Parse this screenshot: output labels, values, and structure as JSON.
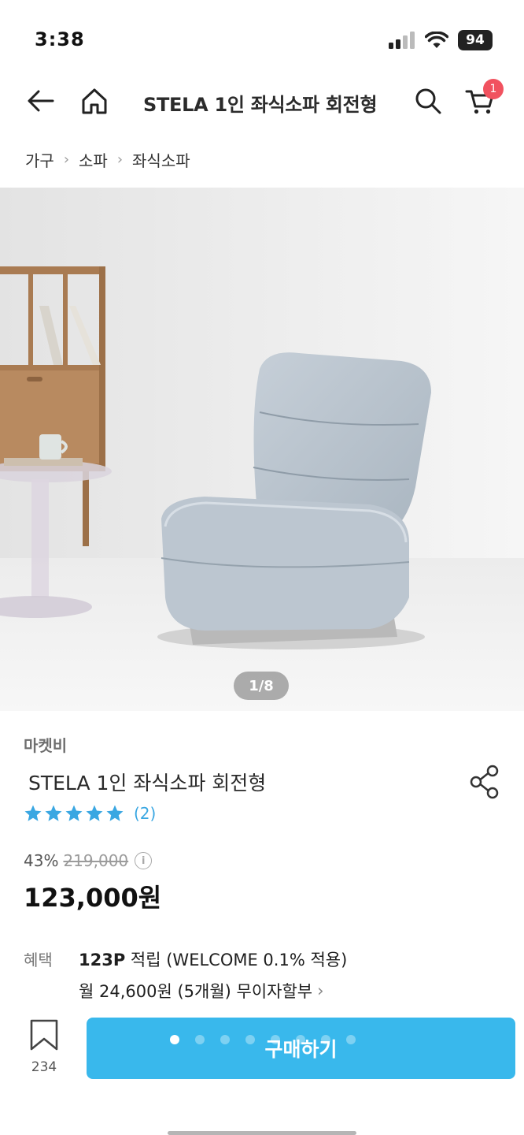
{
  "status_bar": {
    "time": "3:38",
    "battery": "94"
  },
  "nav": {
    "title": "STELA 1인 좌식소파 회전형",
    "cart_count": "1"
  },
  "breadcrumb": [
    "가구",
    "소파",
    "좌식소파"
  ],
  "hero": {
    "counter": "1/8",
    "current_image": 1,
    "total_images": 8
  },
  "product": {
    "seller": "마켓비",
    "title": "STELA 1인 좌식소파 회전형",
    "rating": 5,
    "review_count": "(2)",
    "discount_rate": "43%",
    "original_price": "219,000",
    "sale_price": "123,000원"
  },
  "benefit": {
    "label": "혜택",
    "points": "123P",
    "points_text": "적립 (WELCOME 0.1% 적용)",
    "installment": "월 24,600원 (5개월) 무이자할부"
  },
  "bottom_bar": {
    "bookmark_count": "234",
    "buy_label": "구매하기"
  },
  "colors": {
    "accent": "#39b8ec",
    "star": "#3aa7e2",
    "badge": "#f1525f"
  }
}
